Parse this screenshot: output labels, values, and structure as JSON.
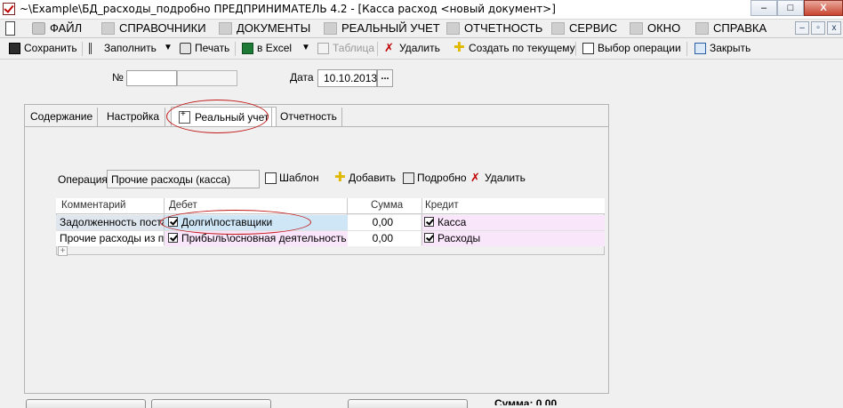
{
  "window": {
    "title": "~\\Example\\БД_расходы_подробно  ПРЕДПРИНИМАТЕЛЬ 4.2 - [Касса расход <новый документ>]",
    "minimize": "–",
    "maximize": "□",
    "close": "X"
  },
  "menu": {
    "items": [
      {
        "label": "ФАЙЛ",
        "icon": "folder-icon"
      },
      {
        "label": "СПРАВОЧНИКИ",
        "icon": "book-icon"
      },
      {
        "label": "ДОКУМЕНТЫ",
        "icon": "documents-icon"
      },
      {
        "label": "РЕАЛЬНЫЙ УЧЕТ",
        "icon": "ledger-icon"
      },
      {
        "label": "ОТЧЕТНОСТЬ",
        "icon": "report-icon"
      },
      {
        "label": "СЕРВИС",
        "icon": "service-icon"
      },
      {
        "label": "ОКНО",
        "icon": "window-icon"
      },
      {
        "label": "СПРАВКА",
        "icon": "help-icon"
      }
    ],
    "mdi": {
      "minimize": "–",
      "restore": "▫",
      "close": "x"
    }
  },
  "toolbar": {
    "save": "Сохранить",
    "fill": "Заполнить",
    "print": "Печать",
    "excel": "в Excel",
    "table": "Таблица",
    "delete": "Удалить",
    "create_from": "Создать по текущему",
    "select_operation": "Выбор операции",
    "close": "Закрыть"
  },
  "header": {
    "number_label": "№",
    "number_value": "",
    "date_label": "Дата",
    "date_value": "10.10.2013",
    "date_button": "..."
  },
  "tabs": [
    {
      "label": "Содержание",
      "active": false
    },
    {
      "label": "Настройка",
      "active": false
    },
    {
      "label": "Реальный учет",
      "active": true
    },
    {
      "label": "Отчетность",
      "active": false
    }
  ],
  "operation": {
    "label": "Операция",
    "value": "Прочие расходы (касса)",
    "template": "Шаблон",
    "add": "Добавить",
    "detail": "Подробно",
    "delete": "Удалить"
  },
  "grid": {
    "columns": [
      "Комментарий",
      "Дебет",
      "Сумма",
      "Кредит"
    ],
    "rows": [
      {
        "comment": "Задолженность поста",
        "debit": "Долги\\поставщики",
        "sum": "0,00",
        "credit": "Касса"
      },
      {
        "comment": "Прочие расходы из пр",
        "debit": "Прибыль\\основная деятельность",
        "sum": "0,00",
        "credit": "Расходы"
      }
    ],
    "add_row": "+"
  },
  "footer": {
    "total": "Сумма: 0,00"
  },
  "colors": {
    "highlight_ellipse": "#c21818",
    "selected_cell": "#cfe6f7",
    "pink_cell": "#fae6fb"
  }
}
